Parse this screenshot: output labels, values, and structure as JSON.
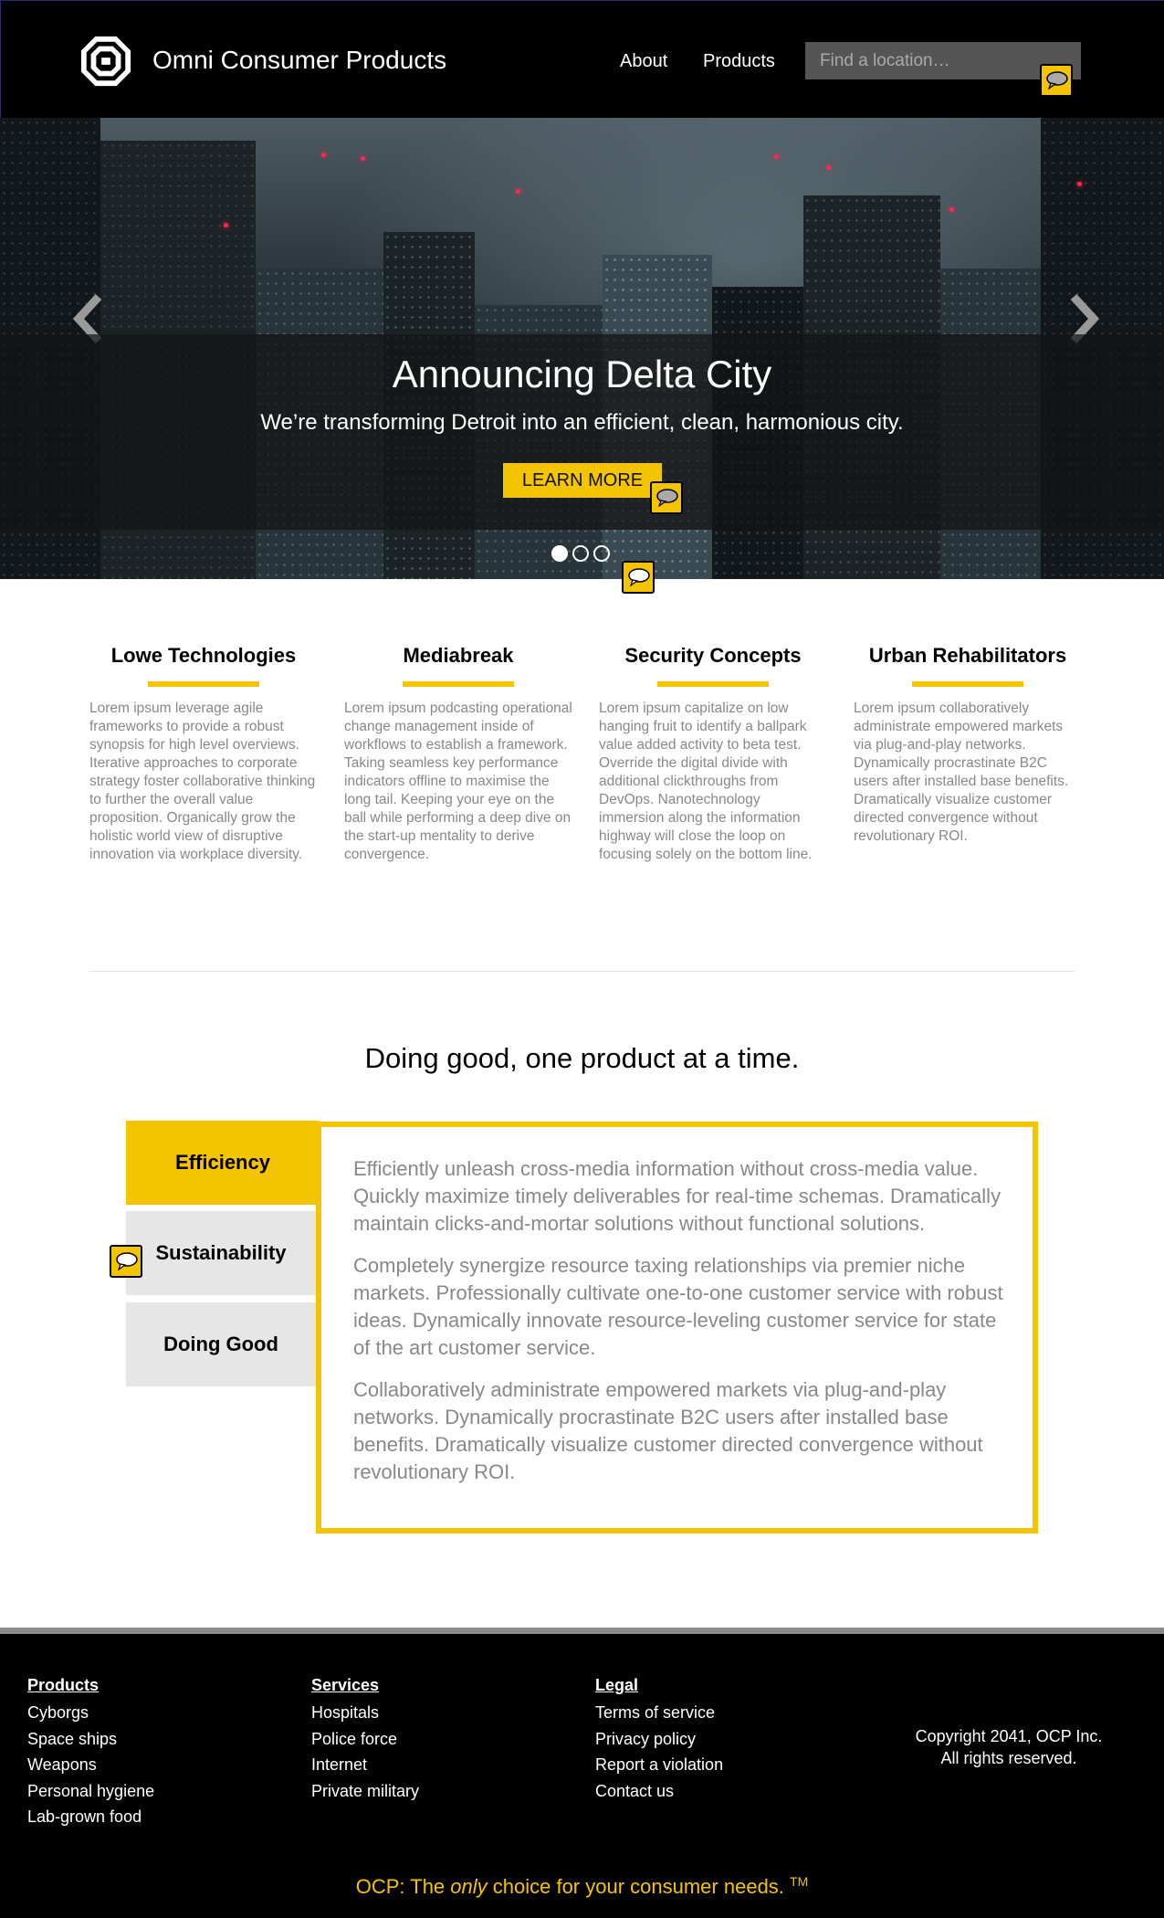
{
  "header": {
    "brand": "Omni Consumer Products",
    "nav": [
      {
        "label": "About"
      },
      {
        "label": "Products"
      }
    ],
    "search": {
      "placeholder": "Find a location…",
      "value": ""
    }
  },
  "hero": {
    "title": "Announcing Delta City",
    "subtitle": "We’re transforming Detroit into an efficient, clean, harmonious city.",
    "button_label": "LEARN MORE",
    "slides_total": 3,
    "active_slide": 1
  },
  "divisions": [
    {
      "title": "Lowe Technologies",
      "text": "Lorem ipsum leverage agile frameworks to provide a robust synopsis for high level overviews. Iterative approaches to corporate strategy foster collaborative thinking to further the overall value proposition. Organically grow the holistic world view of disruptive innovation via workplace diversity."
    },
    {
      "title": "Mediabreak",
      "text": "Lorem ipsum podcasting operational change management inside of workflows to establish a framework. Taking seamless key performance indicators offline to maximise the long tail. Keeping your eye on the ball while performing a deep dive on the start-up mentality to derive convergence."
    },
    {
      "title": "Security Concepts",
      "text": "Lorem ipsum capitalize on low hanging fruit to identify a ballpark value added activity to beta test. Override the digital divide with additional clickthroughs from DevOps. Nanotechnology immersion along the information highway will close the loop on focusing solely on the bottom line."
    },
    {
      "title": "Urban Rehabilitators",
      "text": "Lorem ipsum collaboratively administrate empowered markets via plug-and-play networks. Dynamically procrastinate B2C users after installed base benefits. Dramatically visualize customer directed convergence without revolutionary ROI."
    }
  ],
  "mission": {
    "tagline": "Doing good, one product at a time.",
    "tabs": [
      {
        "label": "Efficiency"
      },
      {
        "label": "Sustainability"
      },
      {
        "label": "Doing Good"
      }
    ],
    "active_tab": "Efficiency",
    "panel_paragraphs": [
      "Efficiently unleash cross-media information without cross-media value. Quickly maximize timely deliverables for real-time schemas. Dramatically maintain clicks-and-mortar solutions without functional solutions.",
      "Completely synergize resource taxing relationships via premier niche markets. Professionally cultivate one-to-one customer service with robust ideas. Dynamically innovate resource-leveling customer service for state of the art customer service.",
      "Collaboratively administrate empowered markets via plug-and-play networks. Dynamically procrastinate B2C users after installed base benefits. Dramatically visualize customer directed convergence without revolutionary ROI."
    ]
  },
  "footer": {
    "columns": [
      {
        "heading": "Products",
        "items": [
          "Cyborgs",
          "Space ships",
          "Weapons",
          "Personal hygiene",
          "Lab-grown food"
        ]
      },
      {
        "heading": "Services",
        "items": [
          "Hospitals",
          "Police force",
          "Internet",
          "Private military"
        ]
      },
      {
        "heading": "Legal",
        "items": [
          "Terms of service",
          "Privacy policy",
          "Report a violation",
          "Contact us"
        ]
      }
    ],
    "copyright_line1": "Copyright 2041, OCP Inc.",
    "copyright_line2": "All rights reserved.",
    "slogan_prefix": "OCP: The ",
    "slogan_emphasis": "only",
    "slogan_suffix": " choice for your consumer needs. ",
    "slogan_mark": "TM"
  },
  "icons": {
    "logo": "ocp-logo-icon",
    "feedback": "speech-bubble-icon",
    "carousel_prev": "chevron-left-icon",
    "carousel_next": "chevron-right-icon"
  },
  "colors": {
    "accent": "#f5c400",
    "header_bg": "#000000",
    "footer_bg": "#000000",
    "muted_text": "#888888",
    "tab_inactive": "#e6e6e6"
  }
}
